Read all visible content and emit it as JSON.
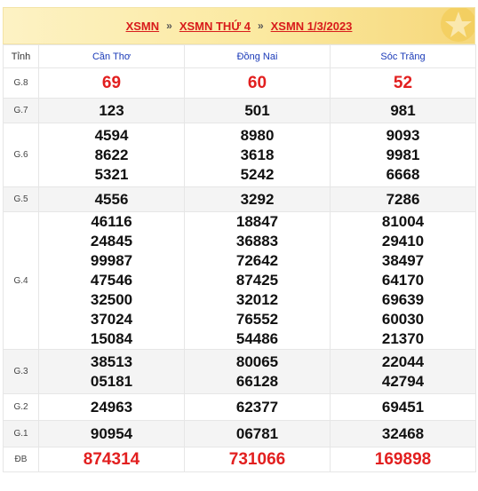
{
  "header": {
    "crumbs": [
      "XSMN",
      "XSMN THỨ 4",
      "XSMN 1/3/2023"
    ],
    "separator": "»"
  },
  "table": {
    "label_header": "Tỉnh",
    "provinces": [
      "Cần Thơ",
      "Đồng Nai",
      "Sóc Trăng"
    ],
    "rows": [
      {
        "label": "G.8",
        "values": [
          [
            "69"
          ],
          [
            "60"
          ],
          [
            "52"
          ]
        ]
      },
      {
        "label": "G.7",
        "values": [
          [
            "123"
          ],
          [
            "501"
          ],
          [
            "981"
          ]
        ]
      },
      {
        "label": "G.6",
        "values": [
          [
            "4594",
            "8622",
            "5321"
          ],
          [
            "8980",
            "3618",
            "5242"
          ],
          [
            "9093",
            "9981",
            "6668"
          ]
        ]
      },
      {
        "label": "G.5",
        "values": [
          [
            "4556"
          ],
          [
            "3292"
          ],
          [
            "7286"
          ]
        ]
      },
      {
        "label": "G.4",
        "values": [
          [
            "46116",
            "24845",
            "99987",
            "47546",
            "32500",
            "37024",
            "15084"
          ],
          [
            "18847",
            "36883",
            "72642",
            "87425",
            "32012",
            "76552",
            "54486"
          ],
          [
            "81004",
            "29410",
            "38497",
            "64170",
            "69639",
            "60030",
            "21370"
          ]
        ]
      },
      {
        "label": "G.3",
        "values": [
          [
            "38513",
            "05181"
          ],
          [
            "80065",
            "66128"
          ],
          [
            "22044",
            "42794"
          ]
        ]
      },
      {
        "label": "G.2",
        "values": [
          [
            "24963"
          ],
          [
            "62377"
          ],
          [
            "69451"
          ]
        ]
      },
      {
        "label": "G.1",
        "values": [
          [
            "90954"
          ],
          [
            "06781"
          ],
          [
            "32468"
          ]
        ]
      },
      {
        "label": "ĐB",
        "values": [
          [
            "874314"
          ],
          [
            "731066"
          ],
          [
            "169898"
          ]
        ]
      }
    ]
  },
  "colors": {
    "accent_red": "#e21f1f",
    "province_blue": "#1a3ab8"
  }
}
